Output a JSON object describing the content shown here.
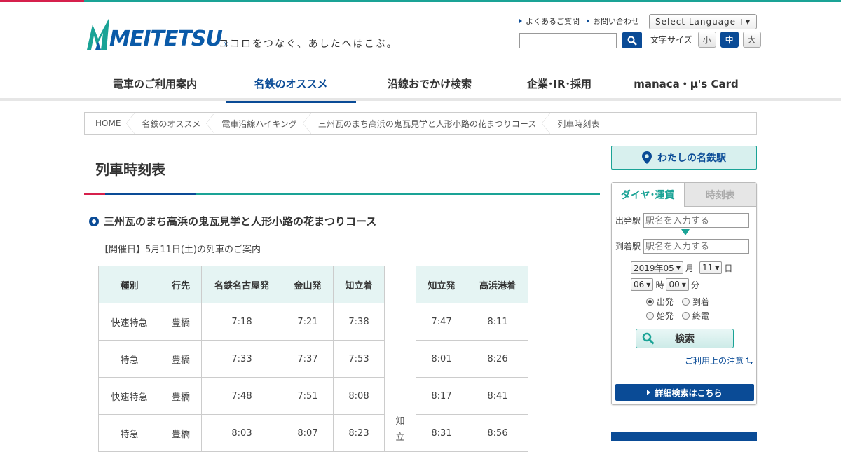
{
  "brand": {
    "logo_text": "MEITETSU",
    "logo_mark": "®",
    "tagline": "ココロをつなぐ、あしたへはこぶ。",
    "colors": {
      "blue": "#0a4b96",
      "green": "#1aa396",
      "red": "#d6204c"
    }
  },
  "utility": {
    "faq": "よくあるご質問",
    "contact": "お問い合わせ",
    "language": "Select Language",
    "search_icon": "search-icon",
    "font_size_label": "文字サイズ",
    "font_small": "小",
    "font_medium": "中",
    "font_large": "大"
  },
  "nav": {
    "items": [
      {
        "label": "電車のご利用案内"
      },
      {
        "label": "名鉄のオススメ",
        "active": true
      },
      {
        "label": "沿線おでかけ検索"
      },
      {
        "label": "企業･IR･採用"
      },
      {
        "label": "manaca・μ's Card"
      }
    ]
  },
  "breadcrumb": [
    "HOME",
    "名鉄のオススメ",
    "電車沿線ハイキング",
    "三州瓦のまち高浜の鬼瓦見学と人形小路の花まつりコース",
    "列車時刻表"
  ],
  "main": {
    "title": "列車時刻表",
    "section_title": "三州瓦のまち高浜の鬼瓦見学と人形小路の花まつりコース",
    "lead": "【開催日】5月11日(土)の列車のご案内",
    "table": {
      "headers_left": [
        "種別",
        "行先",
        "名鉄名古屋発",
        "金山発",
        "知立着"
      ],
      "headers_right": [
        "知立発",
        "高浜港着"
      ],
      "via": [
        "知",
        "立"
      ],
      "rows": [
        {
          "type": "快速特急",
          "dest": "豊橋",
          "nagoya": "7:18",
          "kanayama": "7:21",
          "chiryu_arr": "7:38",
          "chiryu_dep": "7:47",
          "takahama": "8:11"
        },
        {
          "type": "特急",
          "dest": "豊橋",
          "nagoya": "7:33",
          "kanayama": "7:37",
          "chiryu_arr": "7:53",
          "chiryu_dep": "8:01",
          "takahama": "8:26"
        },
        {
          "type": "快速特急",
          "dest": "豊橋",
          "nagoya": "7:48",
          "kanayama": "7:51",
          "chiryu_arr": "8:08",
          "chiryu_dep": "8:17",
          "takahama": "8:41"
        },
        {
          "type": "特急",
          "dest": "豊橋",
          "nagoya": "8:03",
          "kanayama": "8:07",
          "chiryu_arr": "8:23",
          "chiryu_dep": "8:31",
          "takahama": "8:56"
        }
      ]
    }
  },
  "sidebar": {
    "my_meitetsu": "わたしの名鉄駅",
    "tab_dia": "ダイヤ･運賃",
    "tab_timetable": "時刻表",
    "from_label": "出発駅",
    "to_label": "到着駅",
    "station_placeholder": "駅名を入力する",
    "year_month": "2019年05",
    "month_unit": "月",
    "day": "11",
    "day_unit": "日",
    "hour": "06",
    "hour_unit": "時",
    "minute": "00",
    "minute_unit": "分",
    "opt_depart": "出発",
    "opt_arrive": "到着",
    "opt_first": "始発",
    "opt_last": "終電",
    "search_button": "検索",
    "notice": "ご利用上の注意",
    "detail_button": "詳細検索はこちら"
  }
}
